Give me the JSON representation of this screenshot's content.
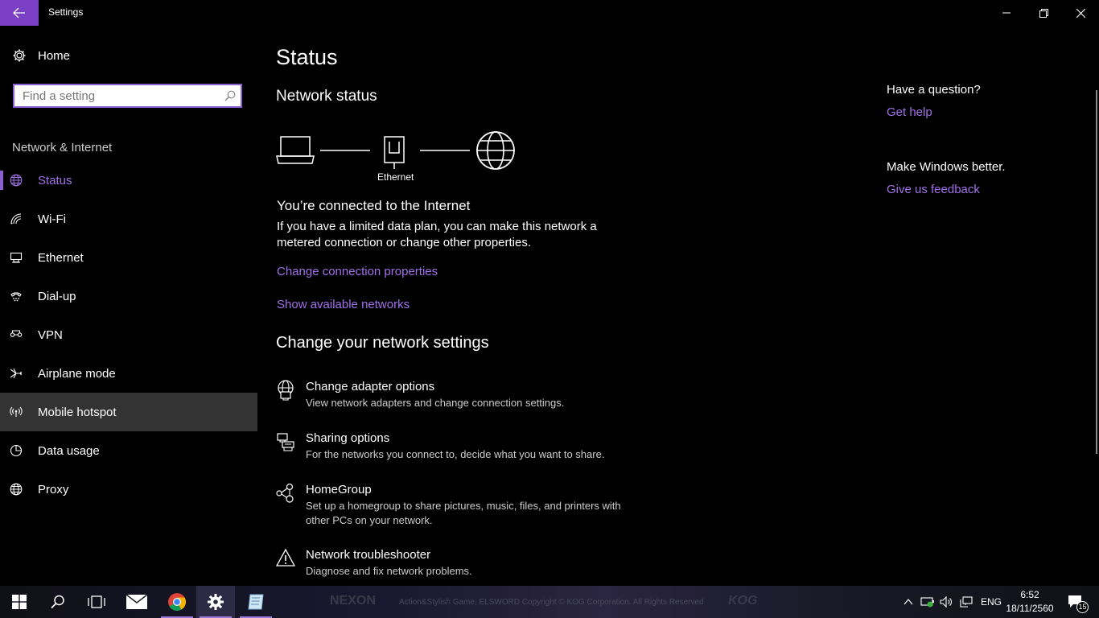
{
  "window": {
    "title": "Settings"
  },
  "sidebar": {
    "home_label": "Home",
    "search_placeholder": "Find a setting",
    "section": "Network & Internet",
    "items": [
      {
        "label": "Status",
        "icon": "globe-icon",
        "state": "selected"
      },
      {
        "label": "Wi-Fi",
        "icon": "wifi-icon"
      },
      {
        "label": "Ethernet",
        "icon": "ethernet-icon"
      },
      {
        "label": "Dial-up",
        "icon": "dialup-icon"
      },
      {
        "label": "VPN",
        "icon": "vpn-icon"
      },
      {
        "label": "Airplane mode",
        "icon": "airplane-icon"
      },
      {
        "label": "Mobile hotspot",
        "icon": "hotspot-icon",
        "state": "hover"
      },
      {
        "label": "Data usage",
        "icon": "data-usage-icon"
      },
      {
        "label": "Proxy",
        "icon": "proxy-globe-icon"
      }
    ]
  },
  "main": {
    "title": "Status",
    "network_status_heading": "Network status",
    "diagram_label": "Ethernet",
    "connected_heading": "You’re connected to the Internet",
    "connected_text": "If you have a limited data plan, you can make this network a metered connection or change other properties.",
    "link_change_properties": "Change connection properties",
    "link_show_networks": "Show available networks",
    "change_heading": "Change your network settings",
    "options": [
      {
        "title": "Change adapter options",
        "desc": "View network adapters and change connection settings.",
        "icon": "adapter-icon"
      },
      {
        "title": "Sharing options",
        "desc": "For the networks you connect to, decide what you want to share.",
        "icon": "sharing-icon"
      },
      {
        "title": "HomeGroup",
        "desc": "Set up a homegroup to share pictures, music, files, and printers with other PCs on your network.",
        "icon": "homegroup-icon"
      },
      {
        "title": "Network troubleshooter",
        "desc": "Diagnose and fix network problems.",
        "icon": "warning-icon"
      }
    ]
  },
  "right": {
    "question": "Have a question?",
    "get_help": "Get help",
    "better": "Make Windows better.",
    "feedback": "Give us feedback"
  },
  "taskbar": {
    "wallpaper_text_1": "NEXON",
    "wallpaper_text_2": "Action&Stylish Game, ELSWORD Copyright © KOG Corporation. All Rights Reserved",
    "wallpaper_text_3": "KOG",
    "language": "ENG",
    "time": "6:52",
    "date": "18/11/2560",
    "notification_count": "15"
  },
  "colors": {
    "accent": "#8a5fd0",
    "link": "#a070e8",
    "background": "#000000",
    "hover": "#333333"
  }
}
